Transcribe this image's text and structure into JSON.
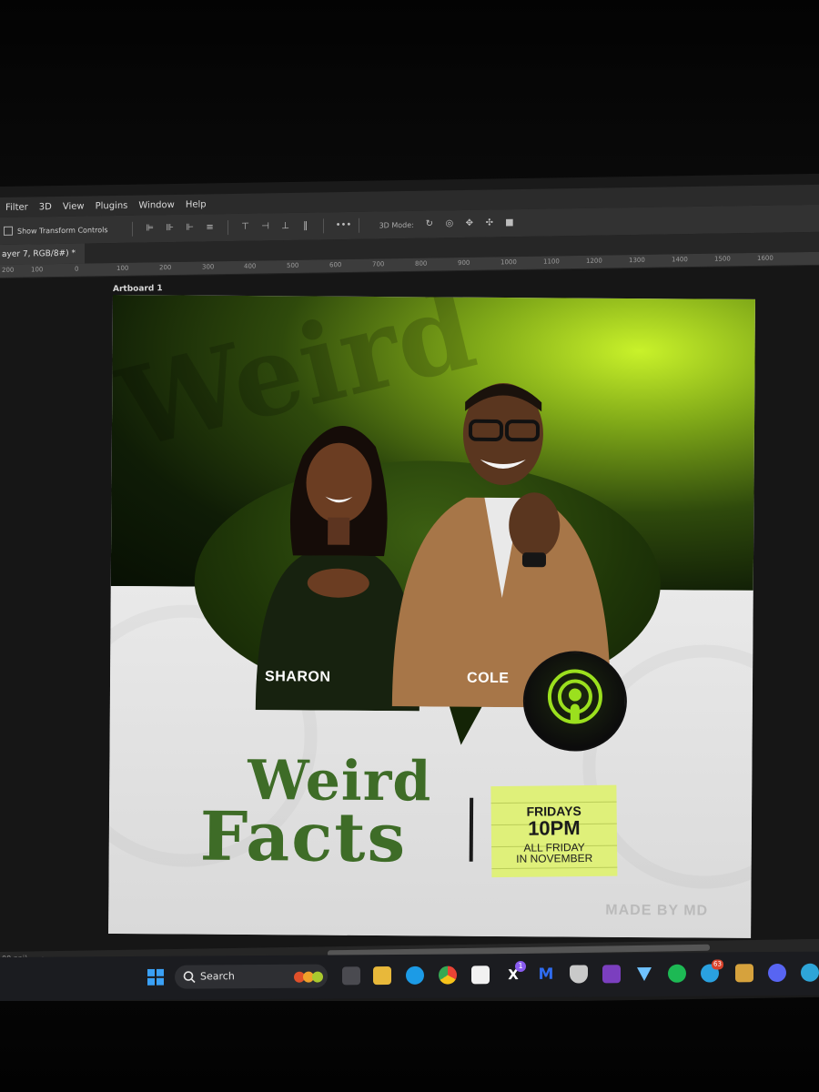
{
  "menu": {
    "items": [
      "Filter",
      "3D",
      "View",
      "Plugins",
      "Window",
      "Help"
    ]
  },
  "options_bar": {
    "show_transform_controls": "Show Transform Controls",
    "mode_3d": "3D Mode:",
    "more": "•••"
  },
  "document": {
    "tab_title": "ayer 7, RGB/8#) *"
  },
  "ruler": {
    "labels": [
      "200",
      "100",
      "0",
      "100",
      "200",
      "300",
      "400",
      "500",
      "600",
      "700",
      "800",
      "900",
      "1000",
      "1100",
      "1200",
      "1300",
      "1400",
      "1500",
      "1600"
    ]
  },
  "canvas": {
    "artboard_label": "Artboard 1"
  },
  "artwork": {
    "host1": "SHARON",
    "host2": "COLE",
    "title_line1": "Weird",
    "title_line2": "Facts",
    "note_line1": "FRIDAYS",
    "note_line2": "10PM",
    "note_line3": "ALL FRIDAY",
    "note_line4": "IN NOVEMBER",
    "watermark": "MADE BY MD",
    "accent_color": "#3e6c27",
    "highlight_color": "#c9f22a"
  },
  "status": {
    "zoom": "00 ppi)",
    "arrow": "›"
  },
  "taskbar": {
    "search_label": "Search",
    "x_badge": "1",
    "telegram_badge": "63",
    "icons": [
      "windows-start-icon",
      "search-icon",
      "fruits-widget-icon",
      "task-view-icon",
      "file-explorer-icon",
      "edge-icon",
      "chrome-icon",
      "store-icon",
      "x-icon",
      "malwarebytes-icon",
      "brave-icon",
      "onenote-icon",
      "proton-vpn-icon",
      "spotify-icon",
      "telegram-icon",
      "avatar-app-icon",
      "discord-icon",
      "copilot-icon"
    ]
  }
}
